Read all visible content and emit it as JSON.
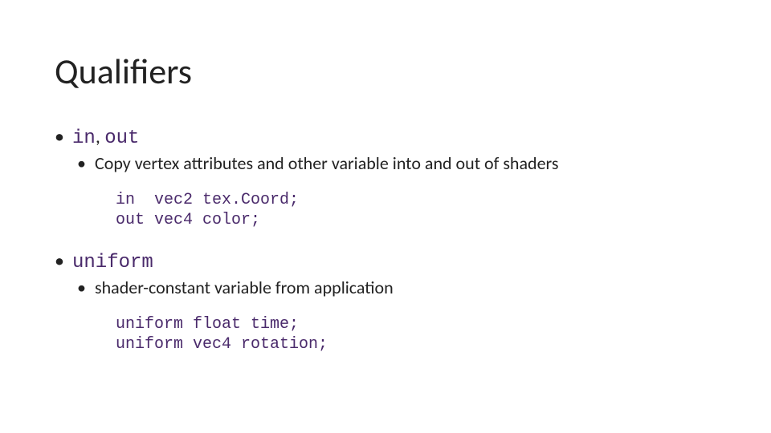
{
  "title": "Qualifiers",
  "section1": {
    "kw_in": "in",
    "sep": ", ",
    "kw_out": "out",
    "desc": "Copy vertex attributes and other variable into and out of shaders",
    "code": "in  vec2 tex.Coord;\nout vec4 color;"
  },
  "section2": {
    "kw_uniform": "uniform",
    "desc": "shader-constant variable from application",
    "code": "uniform float time;\nuniform vec4 rotation;"
  }
}
